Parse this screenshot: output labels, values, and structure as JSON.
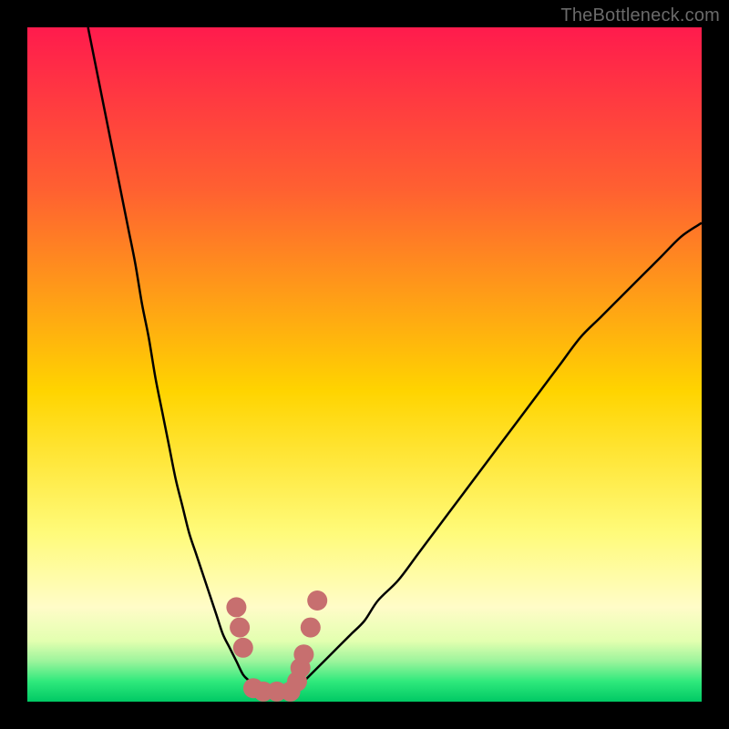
{
  "watermark": "TheBottleneck.com",
  "chart_data": {
    "type": "line",
    "title": "",
    "xlabel": "",
    "ylabel": "",
    "xlim": [
      0,
      100
    ],
    "ylim": [
      0,
      100
    ],
    "grid": false,
    "legend": false,
    "series": [
      {
        "name": "left-curve",
        "x": [
          9,
          10,
          11,
          12,
          13,
          14,
          15,
          16,
          17,
          18,
          19,
          20,
          21,
          22,
          23,
          24,
          25,
          26,
          27,
          28,
          29,
          30,
          31,
          32,
          33,
          34,
          35
        ],
        "values": [
          100,
          95,
          90,
          85,
          80,
          75,
          70,
          65,
          59,
          54,
          48,
          43,
          38,
          33,
          29,
          25,
          22,
          19,
          16,
          13,
          10,
          8,
          6,
          4,
          3,
          2,
          1
        ]
      },
      {
        "name": "right-curve",
        "x": [
          40,
          42,
          44,
          46,
          48,
          50,
          52,
          55,
          58,
          61,
          64,
          67,
          70,
          73,
          76,
          79,
          82,
          85,
          88,
          91,
          94,
          97,
          100
        ],
        "values": [
          2,
          4,
          6,
          8,
          10,
          12,
          15,
          18,
          22,
          26,
          30,
          34,
          38,
          42,
          46,
          50,
          54,
          57,
          60,
          63,
          66,
          69,
          71
        ]
      }
    ],
    "markers": {
      "name": "highlight-points",
      "color": "#c76f6f",
      "x": [
        31,
        31.5,
        32,
        33.5,
        35,
        37,
        39,
        40,
        40.5,
        41,
        42,
        43
      ],
      "values": [
        14,
        11,
        8,
        2,
        1.5,
        1.5,
        1.5,
        3,
        5,
        7,
        11,
        15
      ]
    },
    "gradient_stops": [
      {
        "offset": 0,
        "color": "#ff1b4d"
      },
      {
        "offset": 24,
        "color": "#ff6031"
      },
      {
        "offset": 54,
        "color": "#ffd400"
      },
      {
        "offset": 75,
        "color": "#fffb7a"
      },
      {
        "offset": 86,
        "color": "#fffcc8"
      },
      {
        "offset": 91,
        "color": "#e3ffb0"
      },
      {
        "offset": 94,
        "color": "#9cf49c"
      },
      {
        "offset": 97,
        "color": "#2fe97c"
      },
      {
        "offset": 100,
        "color": "#00c964"
      }
    ]
  }
}
